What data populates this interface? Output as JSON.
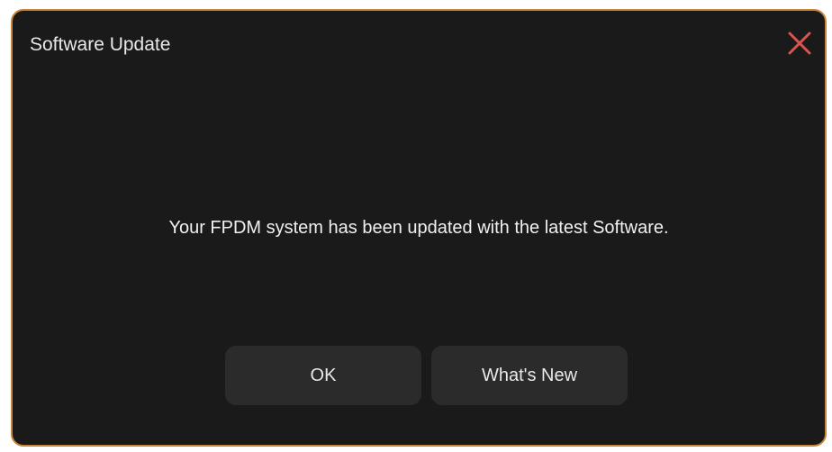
{
  "dialog": {
    "title": "Software Update",
    "message": "Your FPDM system has been updated with the latest Software.",
    "close_icon": "close-icon",
    "close_color": "#d9534f",
    "border_color": "#c8853a",
    "buttons": {
      "ok_label": "OK",
      "whats_new_label": "What's New"
    }
  }
}
